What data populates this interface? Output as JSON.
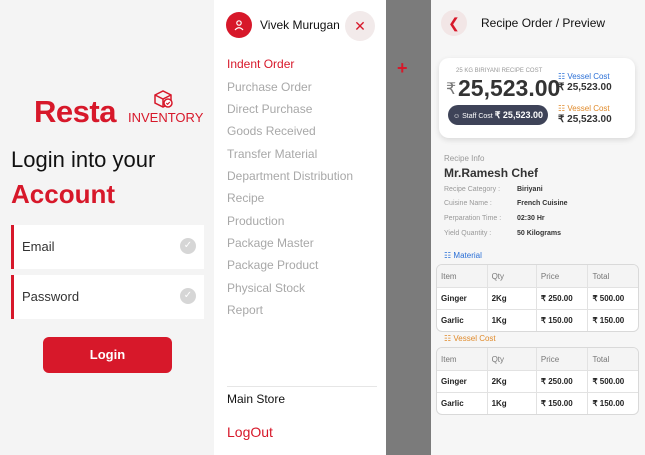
{
  "login": {
    "logo_main": "Resta",
    "logo_sub": "INVENTORY",
    "heading_line1": "Login into your",
    "heading_line2": "Account",
    "email_label": "Email",
    "password_label": "Password",
    "login_button": "Login"
  },
  "menu": {
    "user_name": "Vivek Murugan",
    "items": [
      "Indent Order",
      "Purchase Order",
      "Direct Purchase",
      "Goods Received",
      "Transfer Material",
      "Department Distribution",
      "Recipe",
      "Production",
      "Package Master",
      "Package Product",
      "Physical Stock",
      "Report"
    ],
    "active_item": "Indent Order",
    "store": "Main Store",
    "logout": "LogOut"
  },
  "recipe": {
    "title": "Recipe Order / Preview",
    "cost_label": "25 KG BIRIYANI RECIPE COST",
    "currency": "₹",
    "cost_amount": "25,523.00",
    "vessel_cost_label": "Vessel Cost",
    "vessel_cost_amount": "₹ 25,523.00",
    "staff_cost_label": "Staff Cost",
    "staff_cost_amount": "₹ 25,523.00",
    "vessel_cost2_label": "Vessel Cost",
    "vessel_cost2_amount": "₹ 25,523.00",
    "info_heading": "Recipe Info",
    "chef": "Mr.Ramesh Chef",
    "fields": [
      {
        "k": "Recipe Category :",
        "v": "Biriyani"
      },
      {
        "k": "Cuisine Name :",
        "v": "French Cuisine"
      },
      {
        "k": "Perparation Time :",
        "v": "02:30 Hr"
      },
      {
        "k": "Yield Quantity :",
        "v": "50 Kilograms"
      }
    ],
    "material_heading": "Material",
    "vessel_heading": "Vessel Cost",
    "columns": [
      "Item",
      "Qty",
      "Price",
      "Total"
    ],
    "material_rows": [
      [
        "Ginger",
        "2Kg",
        "₹ 250.00",
        "₹ 500.00"
      ],
      [
        "Garlic",
        "1Kg",
        "₹ 150.00",
        "₹ 150.00"
      ]
    ],
    "vessel_rows": [
      [
        "Ginger",
        "2Kg",
        "₹ 250.00",
        "₹ 500.00"
      ],
      [
        "Garlic",
        "1Kg",
        "₹ 150.00",
        "₹ 150.00"
      ]
    ]
  },
  "colors": {
    "brand_red": "#d7182a",
    "vessel_blue": "#2a6fd6",
    "vessel_orange": "#e08a2a",
    "pill_dark": "#3e4358"
  }
}
